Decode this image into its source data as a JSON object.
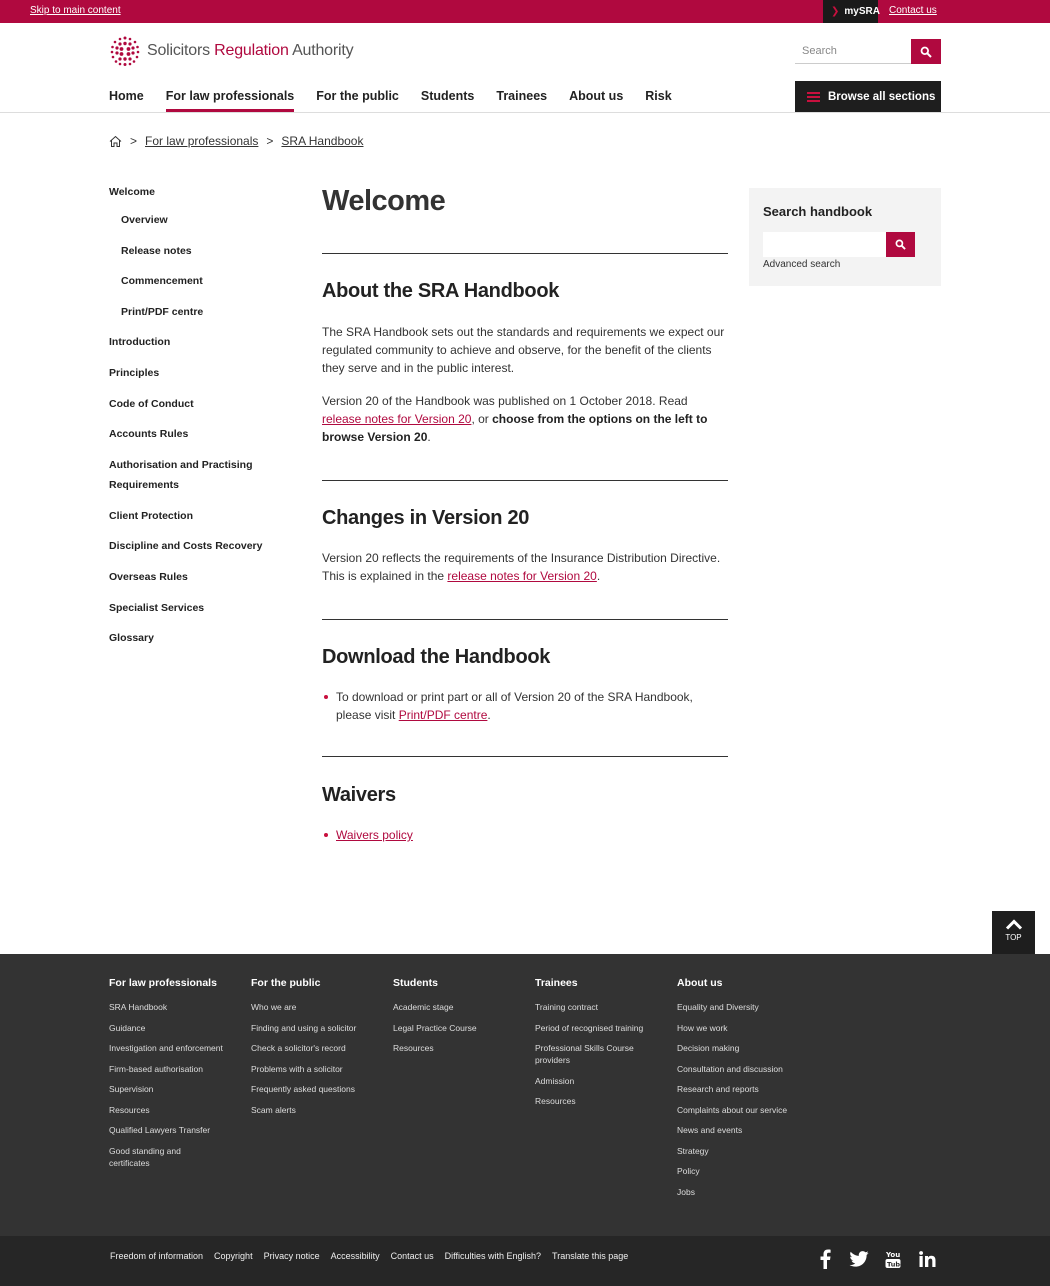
{
  "topbar": {
    "skip_link": "Skip to main content",
    "mysra": "mySRA",
    "contact": "Contact us"
  },
  "header": {
    "logo": {
      "word1": "Solicitors",
      "word2": "Regulation",
      "word3": "Authority"
    },
    "search_placeholder": "Search",
    "nav": [
      "Home",
      "For law professionals",
      "For the public",
      "Students",
      "Trainees",
      "About us",
      "Risk"
    ],
    "active_nav": "For law professionals",
    "browse_label": "Browse all sections"
  },
  "breadcrumb": {
    "items": [
      "For law professionals",
      "SRA Handbook"
    ]
  },
  "sidenav": {
    "items": [
      {
        "label": "Welcome",
        "sub": false
      },
      {
        "label": "Overview",
        "sub": true
      },
      {
        "label": "Release notes",
        "sub": true
      },
      {
        "label": "Commencement",
        "sub": true
      },
      {
        "label": "Print/PDF centre",
        "sub": true
      },
      {
        "label": "Introduction",
        "sub": false
      },
      {
        "label": "Principles",
        "sub": false
      },
      {
        "label": "Code of Conduct",
        "sub": false
      },
      {
        "label": "Accounts Rules",
        "sub": false
      },
      {
        "label": "Authorisation and Practising Requirements",
        "sub": false
      },
      {
        "label": "Client Protection",
        "sub": false
      },
      {
        "label": "Discipline and Costs Recovery",
        "sub": false
      },
      {
        "label": "Overseas Rules",
        "sub": false
      },
      {
        "label": "Specialist Services",
        "sub": false
      },
      {
        "label": "Glossary",
        "sub": false
      }
    ]
  },
  "main": {
    "title": "Welcome",
    "about": {
      "heading": "About the SRA Handbook",
      "p1": "The SRA Handbook sets out the standards and requirements we expect our regulated community to achieve and observe, for the benefit of the clients they serve and in the public interest.",
      "p2_a": "Version 20 of the Handbook was published on 1 October 2018. Read ",
      "p2_link": "release notes for Version 20",
      "p2_b": ", or ",
      "p2_bold": "choose from the options on the left to browse Version 20",
      "p2_c": "."
    },
    "changes": {
      "heading": "Changes in Version 20",
      "p_a": "Version 20 reflects the requirements of the Insurance Distribution Directive. This is explained in the ",
      "p_link": "release notes for Version 20",
      "p_b": "."
    },
    "download": {
      "heading": "Download the Handbook",
      "bullet_a": "To download or print part or all of Version 20 of the SRA Handbook, please visit ",
      "bullet_link": "Print/PDF centre",
      "bullet_b": "."
    },
    "waivers": {
      "heading": "Waivers",
      "link": "Waivers policy"
    }
  },
  "search_panel": {
    "title": "Search handbook",
    "advanced": "Advanced search"
  },
  "back_to_top": "TOP",
  "footer": {
    "columns": [
      {
        "heading": "For law professionals",
        "links": [
          "SRA Handbook",
          "Guidance",
          "Investigation and enforcement",
          "Firm-based authorisation",
          "Supervision",
          "Resources",
          "Qualified Lawyers Transfer",
          "Good standing and certificates"
        ]
      },
      {
        "heading": "For the public",
        "links": [
          "Who we are",
          "Finding and using a solicitor",
          "Check a solicitor's record",
          "Problems with a solicitor",
          "Frequently asked questions",
          "Scam alerts"
        ]
      },
      {
        "heading": "Students",
        "links": [
          "Academic stage",
          "Legal Practice Course",
          "Resources"
        ]
      },
      {
        "heading": "Trainees",
        "links": [
          "Training contract",
          "Period of recognised training",
          "Professional Skills Course providers",
          "Admission",
          "Resources"
        ]
      },
      {
        "heading": "About us",
        "links": [
          "Equality and Diversity",
          "How we work",
          "Decision making",
          "Consultation and discussion",
          "Research and reports",
          "Complaints about our service",
          "News and events",
          "Strategy",
          "Policy",
          "Jobs"
        ]
      }
    ],
    "bottom_links": [
      "Freedom of information",
      "Copyright",
      "Privacy notice",
      "Accessibility",
      "Contact us",
      "Difficulties with English?",
      "Translate this page"
    ],
    "social": [
      "facebook-icon",
      "twitter-icon",
      "youtube-icon",
      "linkedin-icon"
    ]
  },
  "colors": {
    "brand": "#b0093f",
    "dark": "#1e1e1e",
    "footer": "#333333"
  }
}
